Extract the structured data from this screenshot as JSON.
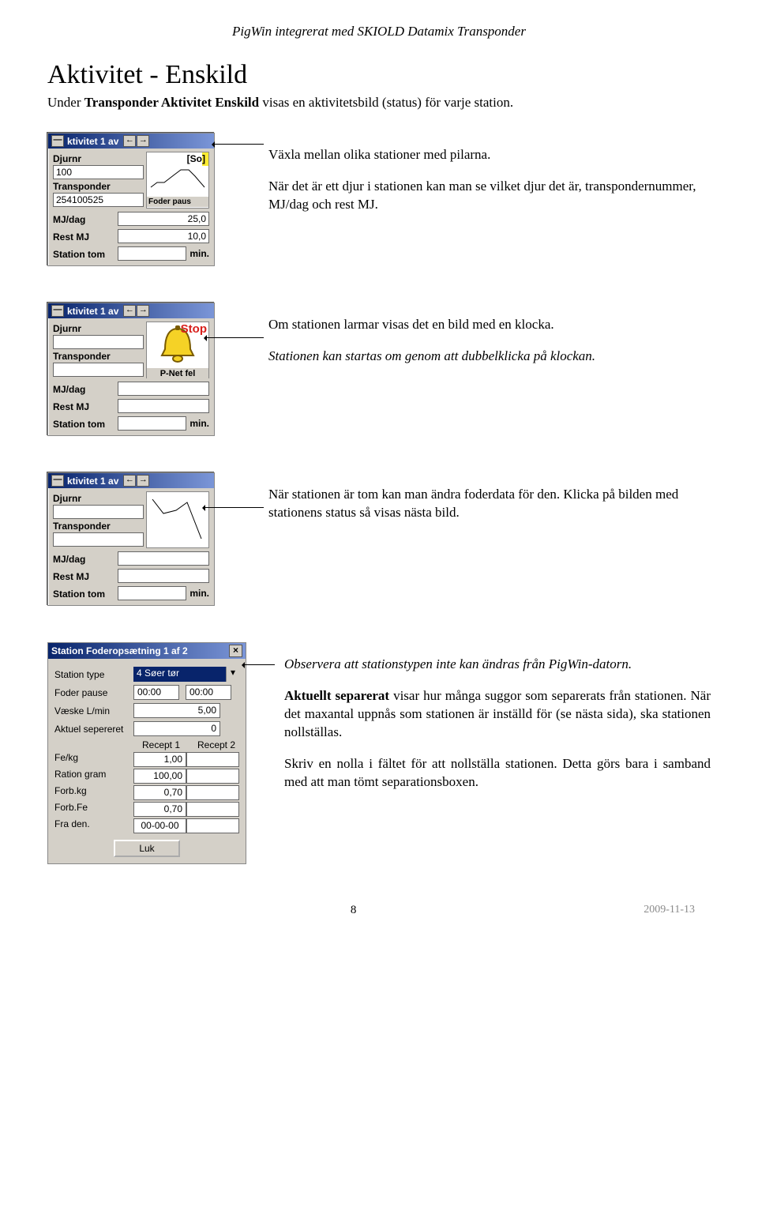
{
  "doc": {
    "header": "PigWin integrerat med SKIOLD Datamix Transponder",
    "title": "Aktivitet - Enskild",
    "intro_pre": "Under ",
    "intro_bold": "Transponder Aktivitet Enskild",
    "intro_post": " visas en aktivitetsbild (status) för varje station.",
    "para1": "Växla mellan olika stationer med pilarna.",
    "para2": "När det är ett djur i stationen kan man se vilket djur det är, transpondernummer, MJ/dag och rest MJ.",
    "para3a": "Om stationen larmar visas det en bild med en klocka.",
    "para3b": "Stationen kan startas om genom att dubbelklicka på klockan.",
    "para4": "När stationen är tom kan man ändra foderdata för den. Klicka på bilden med stationens status så visas nästa bild.",
    "para5": "Observera att stationstypen inte kan ändras från PigWin-datorn.",
    "para6_bold": "Aktuellt separerat",
    "para6_rest": " visar hur många suggor som separerats från stationen. När det maxantal uppnås som stationen är inställd för (se nästa sida), ska stationen nollställas.",
    "para7": "Skriv en nolla i fältet för att nollställa stationen. Detta görs bara i samband med att man tömt separationsboxen.",
    "footer_page": "8",
    "footer_date": "2009-11-13"
  },
  "panel1": {
    "title": "ktivitet 1 av",
    "nav_prev": "←",
    "nav_next": "→",
    "minbtn": "—",
    "lbl_djurnr": "Djurnr",
    "djurnr": "100",
    "lbl_transponder": "Transponder",
    "transponder": "254100525",
    "so": "[So]",
    "foderpaus": "Foder paus",
    "lbl_mjdag": "MJ/dag",
    "mjdag": "25,0",
    "lbl_restmj": "Rest MJ",
    "restmj": "10,0",
    "lbl_stationtom": "Station tom",
    "min": "min."
  },
  "panel2": {
    "title": "ktivitet 1 av",
    "lbl_djurnr": "Djurnr",
    "lbl_transponder": "Transponder",
    "stop": "Stop",
    "pnet": "P-Net fel",
    "lbl_mjdag": "MJ/dag",
    "lbl_restmj": "Rest MJ",
    "lbl_stationtom": "Station tom",
    "min": "min."
  },
  "panel3": {
    "title": "ktivitet 1 av",
    "lbl_djurnr": "Djurnr",
    "lbl_transponder": "Transponder",
    "lbl_mjdag": "MJ/dag",
    "lbl_restmj": "Rest MJ",
    "lbl_stationtom": "Station tom",
    "min": "min."
  },
  "foder": {
    "title": "Station Foderopsætning 1 af 2",
    "close": "×",
    "lbl_stationtype": "Station type",
    "stationtype": "4 Søer tør",
    "lbl_foderpause": "Foder pause",
    "foderpause1": "00:00",
    "foderpause2": "00:00",
    "lbl_vaeske": "Væske L/min",
    "vaeske": "5,00",
    "lbl_aktuel": "Aktuel sepereret",
    "aktuel": "0",
    "recept1": "Recept 1",
    "recept2": "Recept 2",
    "lbl_fekg": "Fe/kg",
    "fekg": "1,00",
    "lbl_ration": "Ration gram",
    "ration": "100,00",
    "lbl_forbkg": "Forb.kg",
    "forbkg": "0,70",
    "lbl_forbfe": "Forb.Fe",
    "forbfe": "0,70",
    "lbl_fraden": "Fra den.",
    "fraden": "00-00-00",
    "luk": "Luk"
  }
}
